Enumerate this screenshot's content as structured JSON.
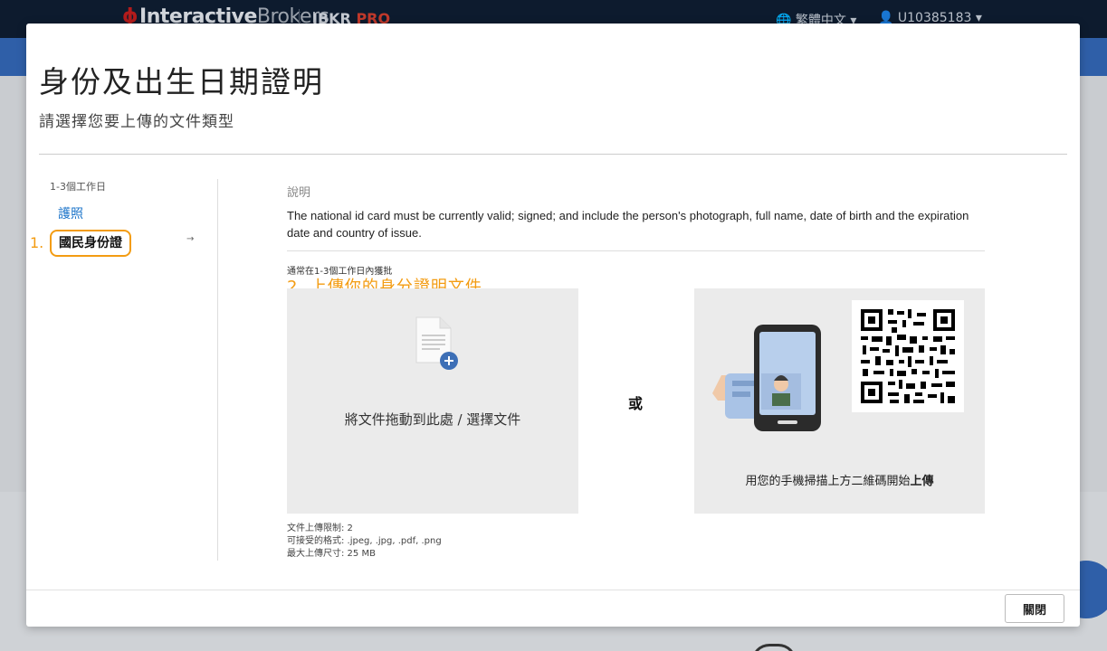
{
  "background": {
    "brand_name": "InteractiveBrokers",
    "brand_bold": "Interactive",
    "brand_light": "Brokers",
    "product": "IBKR",
    "product_accent": "PRO",
    "language": "繁體中文",
    "account": "U10385183"
  },
  "modal": {
    "title": "身份及出生日期證明",
    "subtitle": "請選擇您要上傳的文件類型",
    "sidebar": {
      "processing_days": "1-3個工作日",
      "options": [
        {
          "label": "護照",
          "selected": false
        },
        {
          "label": "國民身份證",
          "selected": true
        }
      ],
      "annotation": "1."
    },
    "description": {
      "heading": "說明",
      "text": "The national id card must be currently valid; signed; and include the person's photograph, full name, date of birth and the expiration date and country of issue."
    },
    "approval_note": "通常在1-3個工作日內獲批",
    "upload_annotation": "2. 上傳你的身分證明文件",
    "dropzone": {
      "text": "將文件拖動到此處 / 選擇文件",
      "icon": "document-add-icon"
    },
    "or_label": "或",
    "qr": {
      "text_prefix": "用您的手機掃描上方二維碼開始",
      "text_bold": "上傳",
      "icon": "phone-scan-icon"
    },
    "limits": {
      "count": "文件上傳限制: 2",
      "formats": "可接受的格式: .jpeg, .jpg, .pdf, .png",
      "size": "最大上傳尺寸: 25 MB"
    },
    "close_label": "關閉"
  },
  "colors": {
    "accent_orange": "#f39c12",
    "link_blue": "#1a73c9",
    "topbar": "#0d1b2e",
    "bluebar": "#2f5fa8"
  }
}
